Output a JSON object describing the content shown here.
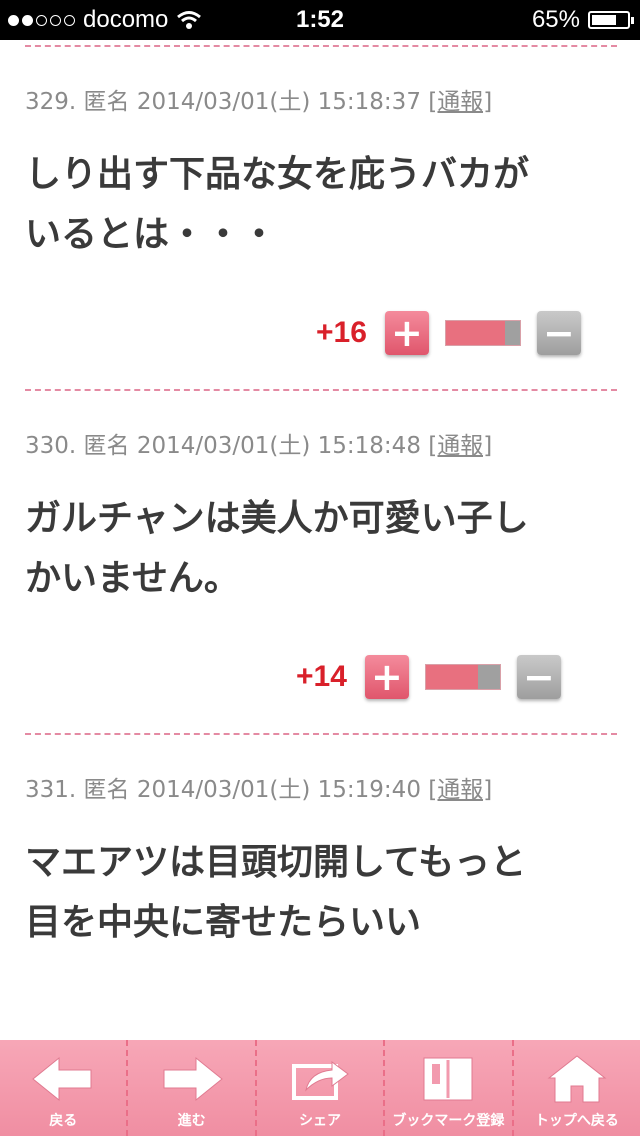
{
  "status": {
    "carrier": "docomo",
    "time": "1:52",
    "battery": "65%",
    "signal_bars": 2
  },
  "comments": [
    {
      "meta": "329. 匿名 2014/03/01(土) 15:18:37",
      "report": "[通報]",
      "lines": [
        "しり出す下品な女を庇うバカが",
        "いるとは・・・"
      ],
      "score": "+16",
      "vote_ratio": 0.8
    },
    {
      "meta": "330. 匿名 2014/03/01(土) 15:18:48",
      "report": "[通報]",
      "lines": [
        "ガルチャンは美人か可愛い子し",
        "かいません。"
      ],
      "score": "+14",
      "vote_ratio": 0.7
    },
    {
      "meta": "331. 匿名 2014/03/01(土) 15:19:40",
      "report": "[通報]",
      "lines": [
        "マエアツは目頭切開してもっと",
        "目を中央に寄せたらいい"
      ]
    }
  ],
  "vote": {
    "plus": "+",
    "minus": "−"
  },
  "toolbar": [
    {
      "label": "戻る",
      "icon": "back-arrow-icon"
    },
    {
      "label": "進む",
      "icon": "forward-arrow-icon"
    },
    {
      "label": "シェア",
      "icon": "share-icon"
    },
    {
      "label": "ブックマーク登録",
      "icon": "bookmark-book-icon"
    },
    {
      "label": "トップへ戻る",
      "icon": "home-icon"
    }
  ],
  "colors": {
    "accent": "#e8707f",
    "score": "#d9202a",
    "separator": "#e48aa3",
    "toolbar": "#f29aae"
  }
}
